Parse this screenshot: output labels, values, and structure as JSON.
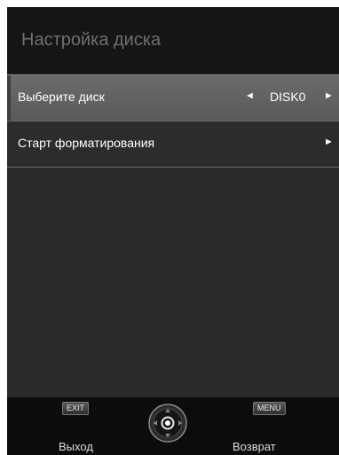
{
  "title": "Настройка диска",
  "rows": [
    {
      "label": "Выберите диск",
      "value": "DISK0",
      "left_arrow": "◄",
      "right_arrow": "►"
    },
    {
      "label": "Старт форматирования",
      "right_arrow": "►"
    }
  ],
  "footer": {
    "exit_key": "EXIT",
    "exit_label": "Выход",
    "menu_key": "MENU",
    "menu_label": "Возврат"
  },
  "colors": {
    "panel_bg": "#2a2a2a",
    "title_bar_bg": "#151515",
    "selected_row_bg": "#666666",
    "footer_bg": "#0c0c0c"
  }
}
